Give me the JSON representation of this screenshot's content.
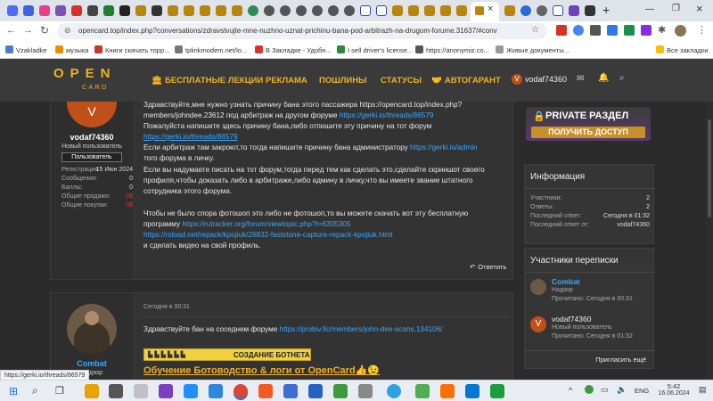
{
  "browser": {
    "url": "opencard.top/index.php?conversations/zdravstvujte-mne-nuzhno-uznat-prichinu-bana-pod-arbitrazh-na-drugom-forume.31637/#conv",
    "new_tab": "+",
    "bookmarks": [
      "Vzakladke",
      "музыка",
      "Книги скачать торр...",
      "tplinkmodem.net/lo...",
      "В Закладке - Удобн...",
      "I sell driver's license...",
      "https://anonymiz.co...",
      "Живые документы...",
      "Все закладки"
    ]
  },
  "site": {
    "logo_top": "OPEN",
    "logo_bottom": "CARD",
    "nav": [
      "БЕСПЛАТНЫЕ ЛЕКЦИИ",
      "РЕКЛАМА",
      "ПОШЛИНЫ",
      "СТАТУСЫ",
      "АВТОГАРАНТ"
    ],
    "username": "vodaf74360",
    "avatar_letter": "V"
  },
  "post1": {
    "avatar_letter": "V",
    "author": "vodaf74360",
    "role": "Новый пользователь",
    "badge": "Пользователь",
    "stats": [
      {
        "label": "Регистрация:",
        "value": "15 Июн 2024"
      },
      {
        "label": "Сообщения:",
        "value": "0"
      },
      {
        "label": "Баллы:",
        "value": "0"
      },
      {
        "label": "Общие продажи:",
        "value": "0$"
      },
      {
        "label": "Общие покупки:",
        "value": "0$"
      }
    ],
    "l1": "Здравствуйте,мне нужно узнать причину бана этого пассажира https://opencard.top/index.php?",
    "l2a": "members/johndee.23612 под арбитраж на другом форуме ",
    "l2b": "https://gerki.io/threads/86579",
    "l3": "Пожалуйста напишите здесь причину бана,либо отпишите эту причину на тот форум",
    "l4": "https://gerki.io/threads/86579",
    "l5a": "Если арбитраж там закроют,то тогда напишите причину бана администратору ",
    "l5b": "https://gerki.io/admin",
    "l6": "того форума в личку.",
    "l7": "Если вы надумаете писать на тот форум,тогда перед тем как сделать это,сделайте скриншот своего",
    "l8": "профиля,чтобы доказать либо в арбитраже,либо админу в личку,что вы имеете звание штатного",
    "l9": "сотрудника этого форума.",
    "l10": "Чтобы не было спора фотошоп это либо не фотошоп,то вы можете скачать вот эту бесплатную",
    "l11a": "программу ",
    "l11b": "https://rutracker.org/forum/viewtopic.php?t=6305305",
    "l12": "https://rsload.net/repack/kpojiuk/26832-faststone-capture-repack-kpojiuk.html",
    "l13": "и сделать видео на свой профиль.",
    "reply": "Ответить"
  },
  "post2": {
    "author": "Combat",
    "role": "Надзор",
    "date": "Сегодня в 00:31",
    "text_a": "Здравствуйте бан на соседнем форуме ",
    "text_b": "https://probiv.llc/members/john-dee-scans.134106/",
    "banner": "СОЗДАНИЕ БОТНЕТА",
    "promo": "Обучение Ботоводство & логи от OpenCard👍😉"
  },
  "sidebar": {
    "private_title": "PRIVATE РАЗДЕЛ",
    "private_btn": "ПОЛУЧИТЬ ДОСТУП",
    "info_title": "Информация",
    "info": [
      {
        "label": "Участники:",
        "value": "2"
      },
      {
        "label": "Ответы:",
        "value": "2"
      },
      {
        "label": "Последний ответ:",
        "value": "Сегодня в 01:32"
      },
      {
        "label": "Последний ответ от:",
        "value": "vodaf74360"
      }
    ],
    "participants_title": "Участники переписки",
    "participants": [
      {
        "name": "Combat",
        "role": "Надзор",
        "read": "Прочитано: Сегодня в 00:31"
      },
      {
        "name": "vodaf74360",
        "role": "Новый пользователь",
        "read": "Прочитано: Сегодня в 01:32"
      }
    ],
    "invite": "Пригласить ещё"
  },
  "statusbar_url": "https://gerki.io/threads/86579",
  "taskbar": {
    "lang": "ENG",
    "time": "5:42",
    "date": "16.06.2024"
  },
  "colors": {
    "accent": "#f0b020",
    "link": "#3aa8ff",
    "avatar": "#c0501a"
  }
}
